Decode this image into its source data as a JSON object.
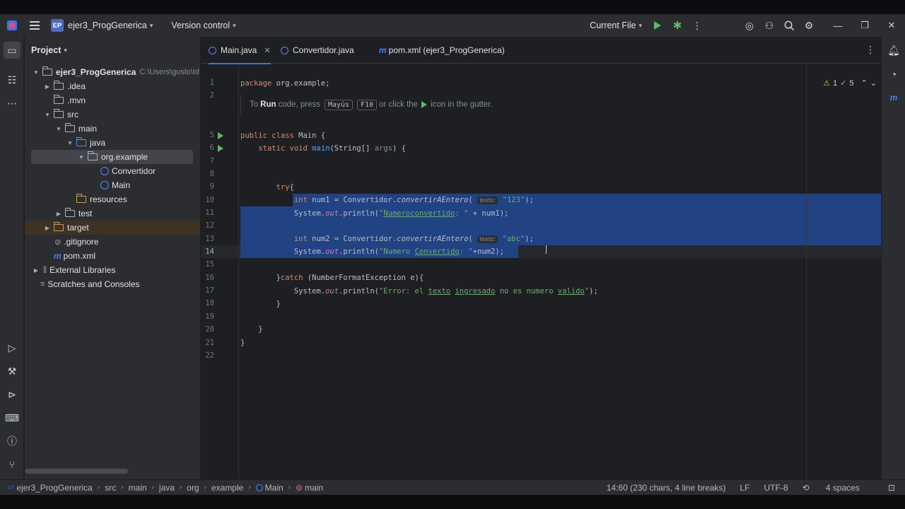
{
  "titlebar": {
    "project_badge": "EP",
    "project_name": "ejer3_ProgGenerica",
    "version_control": "Version control",
    "run_config": "Current File"
  },
  "project_panel": {
    "title": "Project",
    "tree": [
      {
        "label": "ejer3_ProgGenerica",
        "extra": "C:\\Users\\guslo\\Id",
        "icon": "folder-icon"
      },
      {
        "label": ".idea",
        "icon": "folder-icon"
      },
      {
        "label": ".mvn",
        "icon": "folder-icon"
      },
      {
        "label": "src",
        "icon": "folder-icon"
      },
      {
        "label": "main",
        "icon": "folder-icon"
      },
      {
        "label": "java",
        "icon": "folder-icon"
      },
      {
        "label": "org.example",
        "icon": "package-icon"
      },
      {
        "label": "Convertidor",
        "icon": "class-icon"
      },
      {
        "label": "Main",
        "icon": "class-icon"
      },
      {
        "label": "resources",
        "icon": "folder-icon"
      },
      {
        "label": "test",
        "icon": "folder-icon"
      },
      {
        "label": "target",
        "icon": "folder-icon"
      },
      {
        "label": ".gitignore",
        "icon": "gitignore-icon"
      },
      {
        "label": "pom.xml",
        "icon": "maven-icon"
      },
      {
        "label": "External Libraries",
        "icon": "library-icon"
      },
      {
        "label": "Scratches and Consoles",
        "icon": "scratches-icon"
      }
    ]
  },
  "tabs": [
    {
      "label": "Main.java",
      "active": true
    },
    {
      "label": "Convertidor.java",
      "active": false
    },
    {
      "label": "pom.xml (ejer3_ProgGenerica)",
      "active": false
    }
  ],
  "editor": {
    "line_numbers": [
      "1",
      "2",
      "5",
      "6",
      "7",
      "8",
      "9",
      "10",
      "11",
      "12",
      "13",
      "14",
      "15",
      "16",
      "17",
      "18",
      "19",
      "20",
      "21",
      "22"
    ],
    "inlay_hint": {
      "prefix": "To",
      "run": "Run",
      "mid": "code, press",
      "key1": "Mayús",
      "key2": "F10",
      "suffix1": "or click the",
      "suffix2": "icon in the gutter."
    },
    "param_hint": "texto:",
    "inspections": {
      "warnings": "1",
      "weak_warnings": "5"
    }
  },
  "statusbar": {
    "breadcrumb": [
      "ejer3_ProgGenerica",
      "src",
      "main",
      "java",
      "org",
      "example",
      "Main",
      "main"
    ],
    "position": "14:60 (230 chars, 4 line breaks)",
    "line_sep": "LF",
    "encoding": "UTF-8",
    "indent": "4 spaces"
  }
}
